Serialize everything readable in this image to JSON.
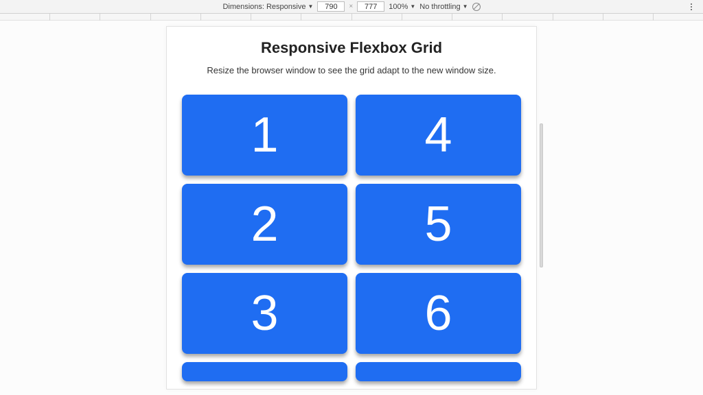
{
  "devtools": {
    "dimensions_label": "Dimensions:",
    "device_mode": "Responsive",
    "width": "790",
    "height": "777",
    "zoom": "100%",
    "throttling": "No throttling"
  },
  "page": {
    "title": "Responsive Flexbox Grid",
    "subtitle": "Resize the browser window to see the grid adapt to the new window size.",
    "tiles": [
      "1",
      "2",
      "3",
      "4",
      "5",
      "6"
    ]
  }
}
